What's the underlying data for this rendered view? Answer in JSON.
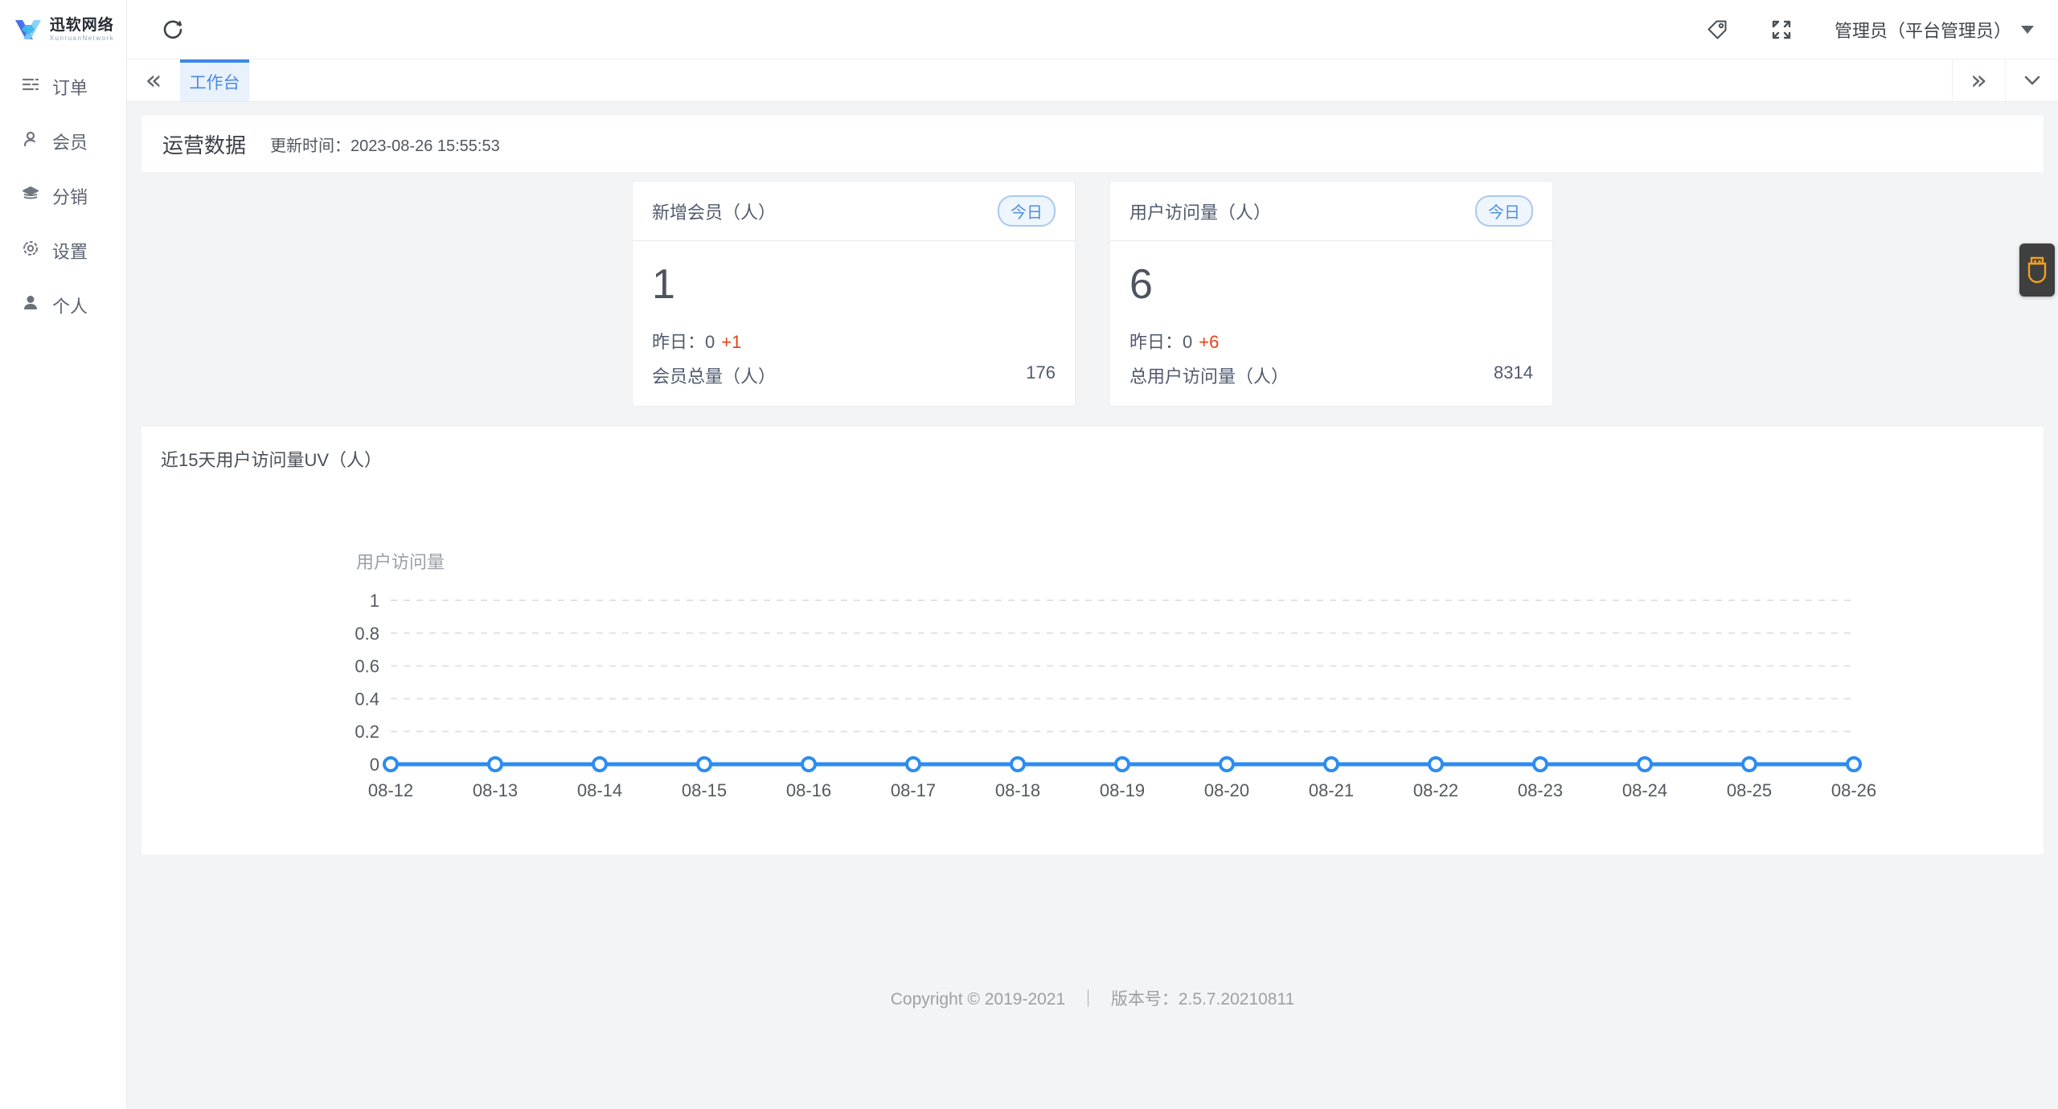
{
  "app": {
    "logo_title": "迅软网络",
    "logo_subtitle": "XunruanNetwork"
  },
  "sidebar": {
    "items": [
      {
        "label": "订单",
        "icon": "order-icon"
      },
      {
        "label": "会员",
        "icon": "member-icon"
      },
      {
        "label": "分销",
        "icon": "distribution-icon"
      },
      {
        "label": "设置",
        "icon": "settings-icon"
      },
      {
        "label": "个人",
        "icon": "profile-icon"
      }
    ]
  },
  "header": {
    "user_label": "管理员（平台管理员）"
  },
  "tabs": {
    "active_label": "工作台"
  },
  "overview": {
    "title": "运营数据",
    "update_text": "更新时间：2023-08-26 15:55:53"
  },
  "cards": [
    {
      "title": "新增会员（人）",
      "badge": "今日",
      "value": "1",
      "yesterday_label": "昨日：",
      "yesterday_value": "0",
      "delta": "+1",
      "total_label": "会员总量（人）",
      "total_value": "176"
    },
    {
      "title": "用户访问量（人）",
      "badge": "今日",
      "value": "6",
      "yesterday_label": "昨日：",
      "yesterday_value": "0",
      "delta": "+6",
      "total_label": "总用户访问量（人）",
      "total_value": "8314"
    }
  ],
  "chart_panel": {
    "title": "近15天用户访问量UV（人）"
  },
  "chart_data": {
    "type": "line",
    "title": "近15天用户访问量UV（人）",
    "x": [
      "08-12",
      "08-13",
      "08-14",
      "08-15",
      "08-16",
      "08-17",
      "08-18",
      "08-19",
      "08-20",
      "08-21",
      "08-22",
      "08-23",
      "08-24",
      "08-25",
      "08-26"
    ],
    "series": [
      {
        "name": "用户访问量",
        "values": [
          0,
          0,
          0,
          0,
          0,
          0,
          0,
          0,
          0,
          0,
          0,
          0,
          0,
          0,
          0
        ]
      }
    ],
    "ylim": [
      0,
      1
    ],
    "yticks": [
      0,
      0.2,
      0.4,
      0.6,
      0.8,
      1
    ],
    "grid": "dashed",
    "legend_position": "top-left",
    "line_color": "#2d8cf0",
    "marker": "hollow-circle"
  },
  "footer": {
    "copyright": "Copyright © 2019-2021",
    "divider": "｜",
    "version": "版本号：2.5.7.20210811"
  },
  "colors": {
    "primary": "#2d8cf0",
    "tab_active_bg": "#e8f1fc",
    "tab_active_border": "#3d87e8",
    "delta_red": "#ed3f14",
    "badge_border": "#a9c9f1",
    "widget_orange": "#f0a020",
    "widget_bg": "#3f3f3f",
    "content_bg": "#f3f4f5"
  }
}
